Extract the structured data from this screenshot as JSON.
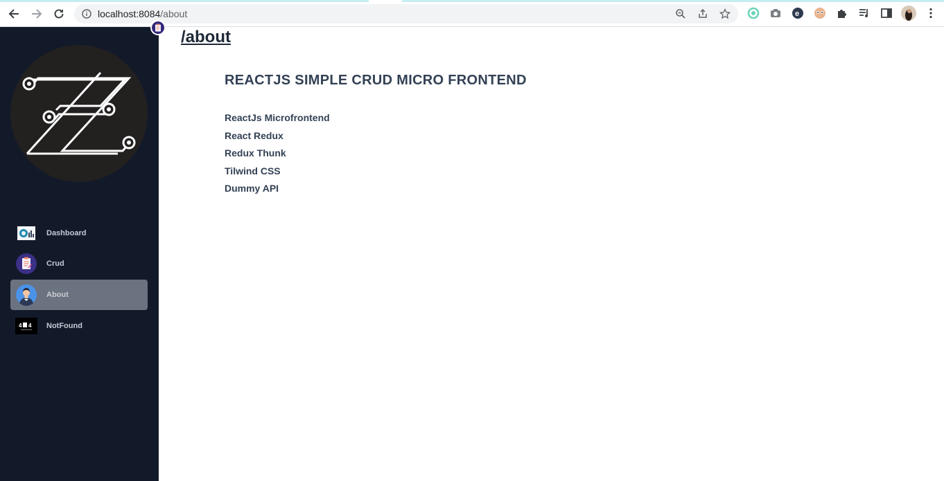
{
  "browser": {
    "url_host": "localhost:8084",
    "url_path": "/about"
  },
  "sidebar": {
    "items": [
      {
        "label": "Dashboard",
        "icon": "dashboard-thumbnail-icon",
        "active": false
      },
      {
        "label": "Crud",
        "icon": "crud-clipboard-icon",
        "active": false
      },
      {
        "label": "About",
        "icon": "about-avatar-icon",
        "active": true
      },
      {
        "label": "NotFound",
        "icon": "notfound-404-icon",
        "active": false
      }
    ]
  },
  "main": {
    "route_title": "/about",
    "heading": "REACTJS SIMPLE CRUD MICRO FRONTEND",
    "tech": [
      "ReactJs Microfrontend",
      "React Redux",
      "Redux Thunk",
      "Tilwind CSS",
      "Dummy API"
    ]
  },
  "colors": {
    "sidebar_bg": "#121a2a",
    "active_item_bg": "#6b7280",
    "heading_text": "#334155"
  }
}
